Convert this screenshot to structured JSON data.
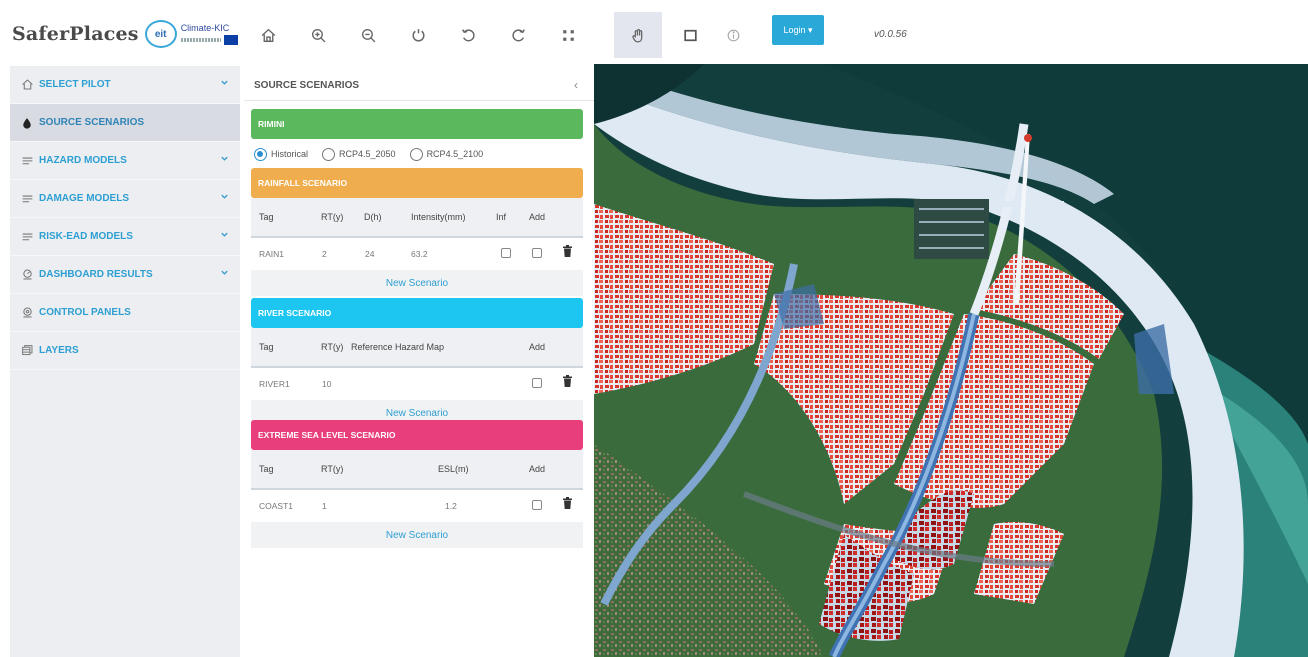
{
  "app": {
    "brand": "SaferPlaces",
    "eit_logo": "eit",
    "partner_logo": "Climate-KIC",
    "version": "v0.0.56"
  },
  "toolbar": {
    "tools": [
      {
        "icon": "home-icon"
      },
      {
        "icon": "zoom-in-icon"
      },
      {
        "icon": "zoom-out-icon"
      },
      {
        "icon": "rotate-icon"
      },
      {
        "icon": "undo-icon"
      },
      {
        "icon": "redo-icon"
      },
      {
        "icon": "extent-icon"
      },
      {
        "icon": "pan-hand-icon",
        "active": true
      },
      {
        "icon": "select-box-icon"
      },
      {
        "icon": "info-icon"
      }
    ],
    "login_label": "Login ▾"
  },
  "sidebar": {
    "items": [
      {
        "label": "SELECT PILOT",
        "icon": "home-icon",
        "chevron": true
      },
      {
        "label": "SOURCE SCENARIOS",
        "icon": "drop-icon",
        "chevron": false,
        "selected": true
      },
      {
        "label": "HAZARD MODELS",
        "icon": "waves-icon",
        "chevron": true
      },
      {
        "label": "DAMAGE MODELS",
        "icon": "waves-icon",
        "chevron": true
      },
      {
        "label": "RISK-EAD MODELS",
        "icon": "waves-icon",
        "chevron": true
      },
      {
        "label": "DASHBOARD RESULTS",
        "icon": "dashboard-icon",
        "chevron": true
      },
      {
        "label": "CONTROL PANELS",
        "icon": "control-icon",
        "chevron": false
      },
      {
        "label": "LAYERS",
        "icon": "layers-icon",
        "chevron": false
      }
    ]
  },
  "panel": {
    "title": "SOURCE SCENARIOS",
    "collapse_icon": "‹",
    "pilot_banner": "RIMINI",
    "climate_options": [
      {
        "label": "Historical",
        "selected": true
      },
      {
        "label": "RCP4.5_2050",
        "selected": false
      },
      {
        "label": "RCP4.5_2100",
        "selected": false
      }
    ],
    "rainfall": {
      "banner": "RAINFALL SCENARIO",
      "headers": {
        "tag": "Tag",
        "rt": "RT(y)",
        "d": "D(h)",
        "intensity": "Intensity(mm)",
        "inf": "Inf",
        "add": "Add"
      },
      "row": {
        "tag": "RAIN1",
        "rt": "2",
        "d": "24",
        "intensity": "63.2"
      },
      "new_label": "New Scenario"
    },
    "river": {
      "banner": "RIVER SCENARIO",
      "headers": {
        "tag": "Tag",
        "rt": "RT(y)",
        "ref": "Reference Hazard Map",
        "add": "Add"
      },
      "row": {
        "tag": "RIVER1",
        "rt": "10"
      },
      "new_label": "New Scenario"
    },
    "sea": {
      "banner": "EXTREME SEA LEVEL SCENARIO",
      "headers": {
        "tag": "Tag",
        "rt": "RT(y)",
        "esl": "ESL(m)",
        "add": "Add"
      },
      "row": {
        "tag": "COAST1",
        "rt": "1",
        "esl": "1.2"
      },
      "new_label": "New Scenario"
    }
  },
  "colors": {
    "accent": "#2e9fd2",
    "rimini_banner": "#5cb85c",
    "rainfall_banner": "#f0ad4e",
    "river_banner": "#1cc6f0",
    "sea_banner": "#e83e7b",
    "login_button": "#2aa8d8"
  }
}
